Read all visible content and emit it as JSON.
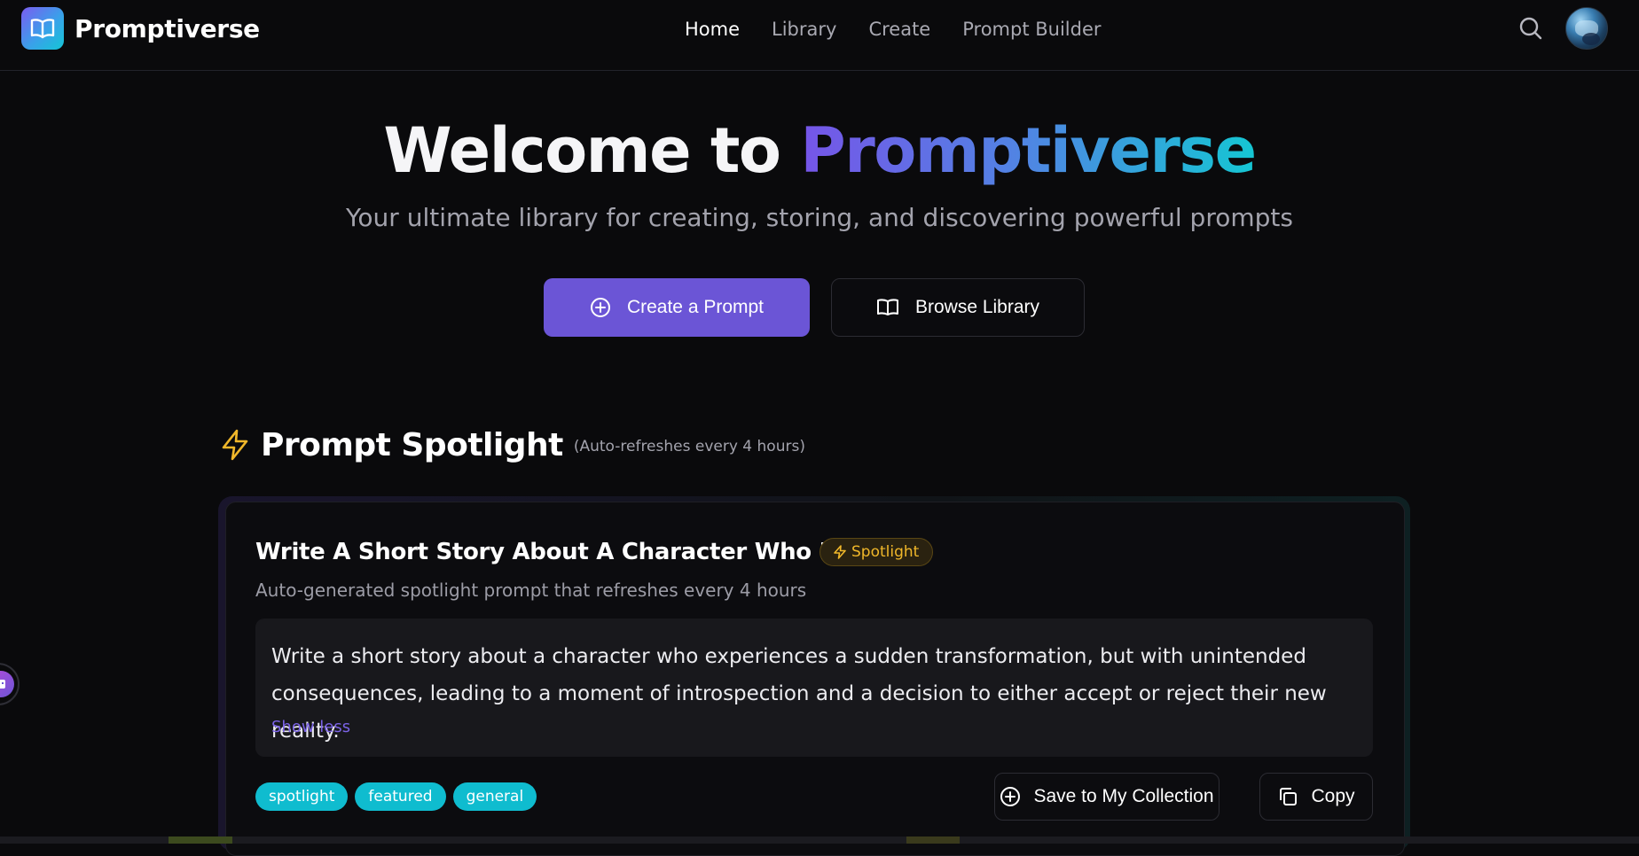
{
  "brand": {
    "name": "Promptiverse",
    "logo_icon": "book-open-icon"
  },
  "nav": {
    "items": [
      {
        "label": "Home",
        "active": true
      },
      {
        "label": "Library",
        "active": false
      },
      {
        "label": "Create",
        "active": false
      },
      {
        "label": "Prompt Builder",
        "active": false
      }
    ]
  },
  "header": {
    "search_icon": "search-icon",
    "avatar_icon": "user-avatar"
  },
  "hero": {
    "title_prefix": "Welcome to ",
    "title_accent": "Promptiverse",
    "subtitle": "Your ultimate library for creating, storing, and discovering powerful prompts",
    "primary_button": "Create a Prompt",
    "secondary_button": "Browse Library"
  },
  "spotlight": {
    "title": "Prompt Spotlight",
    "note": "(Auto-refreshes every 4 hours)",
    "card": {
      "title": "Write A Short Story About A Character Who Exper...",
      "badge": "Spotlight",
      "description": "Auto-generated spotlight prompt that refreshes every 4 hours",
      "prompt_text": "Write a short story about a character who experiences a sudden transformation, but with unintended consequences, leading to a moment of introspection and a decision to either accept or reject their new reality.",
      "show_less": "Show less",
      "tags": [
        "spotlight",
        "featured",
        "general"
      ],
      "save_button": "Save to My Collection",
      "copy_button": "Copy"
    }
  },
  "colors": {
    "background": "#0a0a0c",
    "primary": "#6b55d6",
    "accent_gradient_start": "#7655e8",
    "accent_gradient_end": "#15c6d3",
    "badge_amber": "#f0b72a",
    "tag_cyan": "#0fbccf"
  }
}
